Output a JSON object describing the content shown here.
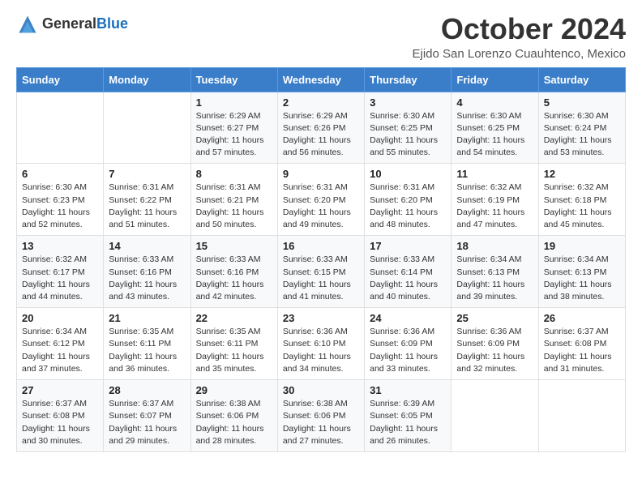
{
  "header": {
    "logo_general": "General",
    "logo_blue": "Blue",
    "title": "October 2024",
    "location": "Ejido San Lorenzo Cuauhtenco, Mexico"
  },
  "days_of_week": [
    "Sunday",
    "Monday",
    "Tuesday",
    "Wednesday",
    "Thursday",
    "Friday",
    "Saturday"
  ],
  "weeks": [
    [
      {
        "day": "",
        "sunrise": "",
        "sunset": "",
        "daylight": ""
      },
      {
        "day": "",
        "sunrise": "",
        "sunset": "",
        "daylight": ""
      },
      {
        "day": "1",
        "sunrise": "Sunrise: 6:29 AM",
        "sunset": "Sunset: 6:27 PM",
        "daylight": "Daylight: 11 hours and 57 minutes."
      },
      {
        "day": "2",
        "sunrise": "Sunrise: 6:29 AM",
        "sunset": "Sunset: 6:26 PM",
        "daylight": "Daylight: 11 hours and 56 minutes."
      },
      {
        "day": "3",
        "sunrise": "Sunrise: 6:30 AM",
        "sunset": "Sunset: 6:25 PM",
        "daylight": "Daylight: 11 hours and 55 minutes."
      },
      {
        "day": "4",
        "sunrise": "Sunrise: 6:30 AM",
        "sunset": "Sunset: 6:25 PM",
        "daylight": "Daylight: 11 hours and 54 minutes."
      },
      {
        "day": "5",
        "sunrise": "Sunrise: 6:30 AM",
        "sunset": "Sunset: 6:24 PM",
        "daylight": "Daylight: 11 hours and 53 minutes."
      }
    ],
    [
      {
        "day": "6",
        "sunrise": "Sunrise: 6:30 AM",
        "sunset": "Sunset: 6:23 PM",
        "daylight": "Daylight: 11 hours and 52 minutes."
      },
      {
        "day": "7",
        "sunrise": "Sunrise: 6:31 AM",
        "sunset": "Sunset: 6:22 PM",
        "daylight": "Daylight: 11 hours and 51 minutes."
      },
      {
        "day": "8",
        "sunrise": "Sunrise: 6:31 AM",
        "sunset": "Sunset: 6:21 PM",
        "daylight": "Daylight: 11 hours and 50 minutes."
      },
      {
        "day": "9",
        "sunrise": "Sunrise: 6:31 AM",
        "sunset": "Sunset: 6:20 PM",
        "daylight": "Daylight: 11 hours and 49 minutes."
      },
      {
        "day": "10",
        "sunrise": "Sunrise: 6:31 AM",
        "sunset": "Sunset: 6:20 PM",
        "daylight": "Daylight: 11 hours and 48 minutes."
      },
      {
        "day": "11",
        "sunrise": "Sunrise: 6:32 AM",
        "sunset": "Sunset: 6:19 PM",
        "daylight": "Daylight: 11 hours and 47 minutes."
      },
      {
        "day": "12",
        "sunrise": "Sunrise: 6:32 AM",
        "sunset": "Sunset: 6:18 PM",
        "daylight": "Daylight: 11 hours and 45 minutes."
      }
    ],
    [
      {
        "day": "13",
        "sunrise": "Sunrise: 6:32 AM",
        "sunset": "Sunset: 6:17 PM",
        "daylight": "Daylight: 11 hours and 44 minutes."
      },
      {
        "day": "14",
        "sunrise": "Sunrise: 6:33 AM",
        "sunset": "Sunset: 6:16 PM",
        "daylight": "Daylight: 11 hours and 43 minutes."
      },
      {
        "day": "15",
        "sunrise": "Sunrise: 6:33 AM",
        "sunset": "Sunset: 6:16 PM",
        "daylight": "Daylight: 11 hours and 42 minutes."
      },
      {
        "day": "16",
        "sunrise": "Sunrise: 6:33 AM",
        "sunset": "Sunset: 6:15 PM",
        "daylight": "Daylight: 11 hours and 41 minutes."
      },
      {
        "day": "17",
        "sunrise": "Sunrise: 6:33 AM",
        "sunset": "Sunset: 6:14 PM",
        "daylight": "Daylight: 11 hours and 40 minutes."
      },
      {
        "day": "18",
        "sunrise": "Sunrise: 6:34 AM",
        "sunset": "Sunset: 6:13 PM",
        "daylight": "Daylight: 11 hours and 39 minutes."
      },
      {
        "day": "19",
        "sunrise": "Sunrise: 6:34 AM",
        "sunset": "Sunset: 6:13 PM",
        "daylight": "Daylight: 11 hours and 38 minutes."
      }
    ],
    [
      {
        "day": "20",
        "sunrise": "Sunrise: 6:34 AM",
        "sunset": "Sunset: 6:12 PM",
        "daylight": "Daylight: 11 hours and 37 minutes."
      },
      {
        "day": "21",
        "sunrise": "Sunrise: 6:35 AM",
        "sunset": "Sunset: 6:11 PM",
        "daylight": "Daylight: 11 hours and 36 minutes."
      },
      {
        "day": "22",
        "sunrise": "Sunrise: 6:35 AM",
        "sunset": "Sunset: 6:11 PM",
        "daylight": "Daylight: 11 hours and 35 minutes."
      },
      {
        "day": "23",
        "sunrise": "Sunrise: 6:36 AM",
        "sunset": "Sunset: 6:10 PM",
        "daylight": "Daylight: 11 hours and 34 minutes."
      },
      {
        "day": "24",
        "sunrise": "Sunrise: 6:36 AM",
        "sunset": "Sunset: 6:09 PM",
        "daylight": "Daylight: 11 hours and 33 minutes."
      },
      {
        "day": "25",
        "sunrise": "Sunrise: 6:36 AM",
        "sunset": "Sunset: 6:09 PM",
        "daylight": "Daylight: 11 hours and 32 minutes."
      },
      {
        "day": "26",
        "sunrise": "Sunrise: 6:37 AM",
        "sunset": "Sunset: 6:08 PM",
        "daylight": "Daylight: 11 hours and 31 minutes."
      }
    ],
    [
      {
        "day": "27",
        "sunrise": "Sunrise: 6:37 AM",
        "sunset": "Sunset: 6:08 PM",
        "daylight": "Daylight: 11 hours and 30 minutes."
      },
      {
        "day": "28",
        "sunrise": "Sunrise: 6:37 AM",
        "sunset": "Sunset: 6:07 PM",
        "daylight": "Daylight: 11 hours and 29 minutes."
      },
      {
        "day": "29",
        "sunrise": "Sunrise: 6:38 AM",
        "sunset": "Sunset: 6:06 PM",
        "daylight": "Daylight: 11 hours and 28 minutes."
      },
      {
        "day": "30",
        "sunrise": "Sunrise: 6:38 AM",
        "sunset": "Sunset: 6:06 PM",
        "daylight": "Daylight: 11 hours and 27 minutes."
      },
      {
        "day": "31",
        "sunrise": "Sunrise: 6:39 AM",
        "sunset": "Sunset: 6:05 PM",
        "daylight": "Daylight: 11 hours and 26 minutes."
      },
      {
        "day": "",
        "sunrise": "",
        "sunset": "",
        "daylight": ""
      },
      {
        "day": "",
        "sunrise": "",
        "sunset": "",
        "daylight": ""
      }
    ]
  ]
}
